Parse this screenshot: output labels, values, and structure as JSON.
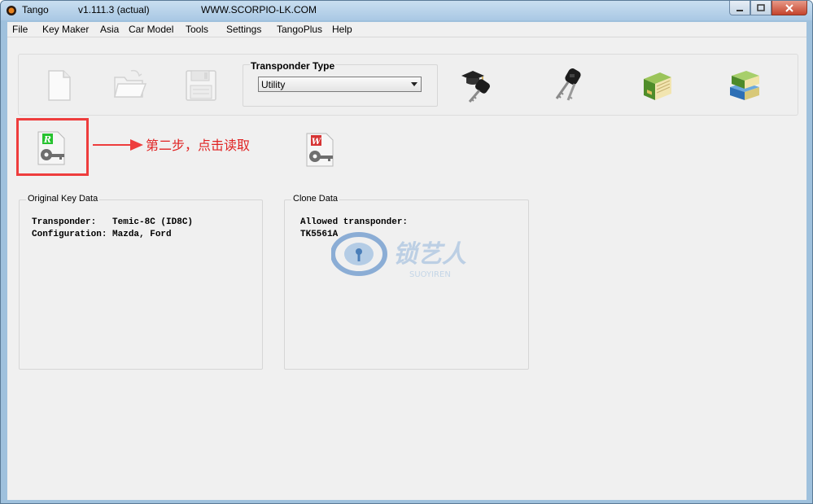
{
  "window": {
    "app_name": "Tango",
    "version": "v1.111.3  (actual)",
    "website": "WWW.SCORPIO-LK.COM"
  },
  "menu": [
    "File",
    "Key Maker",
    "Asia",
    "Car Model",
    "Tools",
    "Settings",
    "TangoPlus",
    "Help"
  ],
  "toolbar": {
    "transponder_type_label": "Transponder Type",
    "transponder_type_value": "Utility",
    "icons": [
      "new-file-icon",
      "open-folder-icon",
      "save-disk-icon",
      "key-graduation-icon",
      "keys-icon",
      "green-book-icon",
      "books-stack-icon"
    ]
  },
  "actions": {
    "read_letter": "R",
    "write_letter": "W"
  },
  "annotation": {
    "text": "第二步，点击读取",
    "color": "#e02222"
  },
  "original_key": {
    "title": "Original Key Data",
    "line1": "Transponder:   Temic-8C (ID8C)",
    "line2": "Configuration: Mazda, Ford"
  },
  "clone": {
    "title": "Clone Data",
    "line1": "Allowed transponder:",
    "line2": "TK5561A"
  },
  "watermark": {
    "chinese": "锁艺人",
    "latin": "SUOYIREN"
  }
}
